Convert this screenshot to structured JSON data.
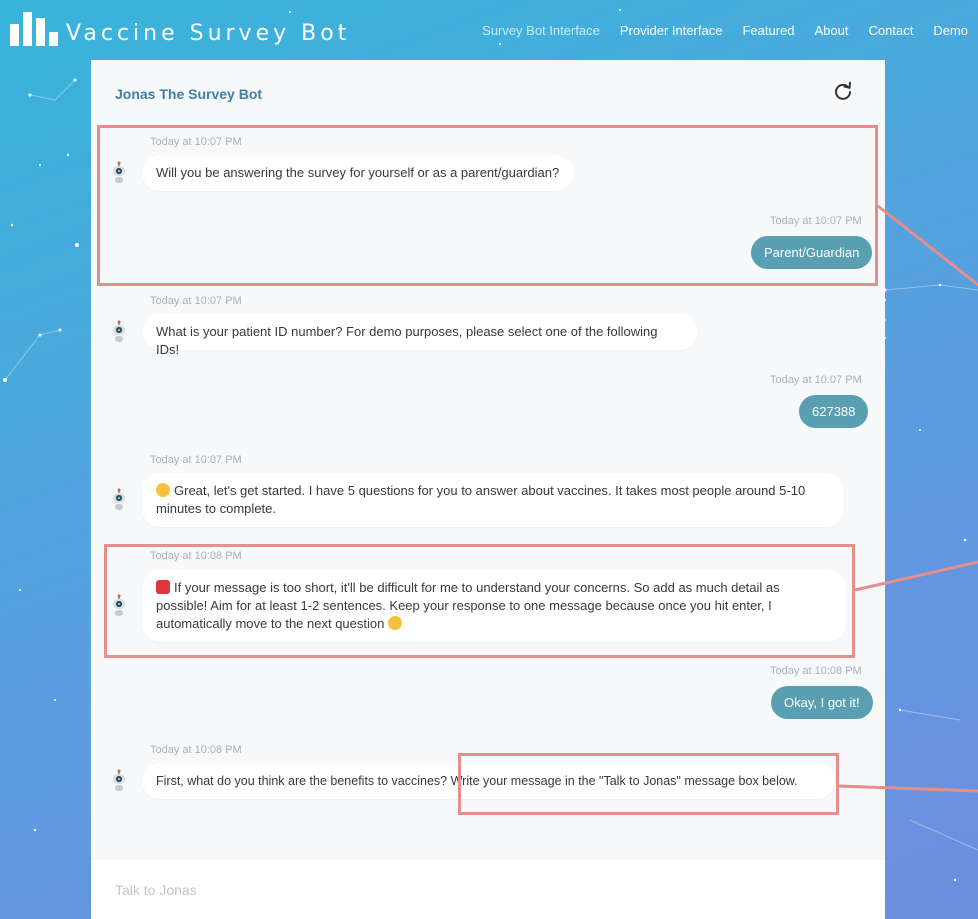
{
  "header": {
    "logo_text": "Vaccine Survey Bot",
    "nav": [
      {
        "label": "Survey Bot Interface",
        "active": true
      },
      {
        "label": "Provider Interface",
        "active": false
      },
      {
        "label": "Featured",
        "active": false
      },
      {
        "label": "About",
        "active": false
      },
      {
        "label": "Contact",
        "active": false
      },
      {
        "label": "Demo",
        "active": false
      }
    ]
  },
  "chat": {
    "title": "Jonas The Survey Bot",
    "refresh_icon": "refresh-icon",
    "bot_avatar_icon": "robot-icon",
    "messages": [
      {
        "sender": "bot",
        "timestamp": "Today at 10:07 PM",
        "text": "Will you be answering the survey for yourself or as a parent/guardian?"
      },
      {
        "sender": "user",
        "timestamp": "Today at 10:07 PM",
        "text": "Parent/Guardian"
      },
      {
        "sender": "bot",
        "timestamp": "Today at 10:07 PM",
        "text": "What is your patient ID number? For demo purposes, please select one of the following IDs!"
      },
      {
        "sender": "user",
        "timestamp": "Today at 10:07 PM",
        "text": "627388"
      },
      {
        "sender": "bot",
        "timestamp": "Today at 10:07 PM",
        "text": "Great, let's get started. I have 5 questions for you to answer about vaccines. It takes most people around 5-10 minutes to complete.",
        "emoji": "smiling-face-emoji"
      },
      {
        "sender": "bot",
        "timestamp": "Today at 10:08 PM",
        "text": "If your message is too short, it'll be difficult for me to understand your concerns. So add as much detail as possible! Aim for at least 1-2 sentences. Keep your response to one message because once you hit enter, I automatically move to the next question",
        "emoji": "siren-emoji",
        "trailing_emoji": "sweat-smile-emoji"
      },
      {
        "sender": "user",
        "timestamp": "Today at 10:08 PM",
        "text": "Okay, I got it!"
      },
      {
        "sender": "bot",
        "timestamp": "Today at 10:08 PM",
        "text": "First, what do you think are the benefits to vaccines? Write your message in the \"Talk to Jonas\" message box below."
      }
    ],
    "input_placeholder": "Talk to Jonas"
  },
  "colors": {
    "user_bubble": "#5a9fb1",
    "title": "#3f7ea6",
    "highlight": "#e88d8d"
  }
}
